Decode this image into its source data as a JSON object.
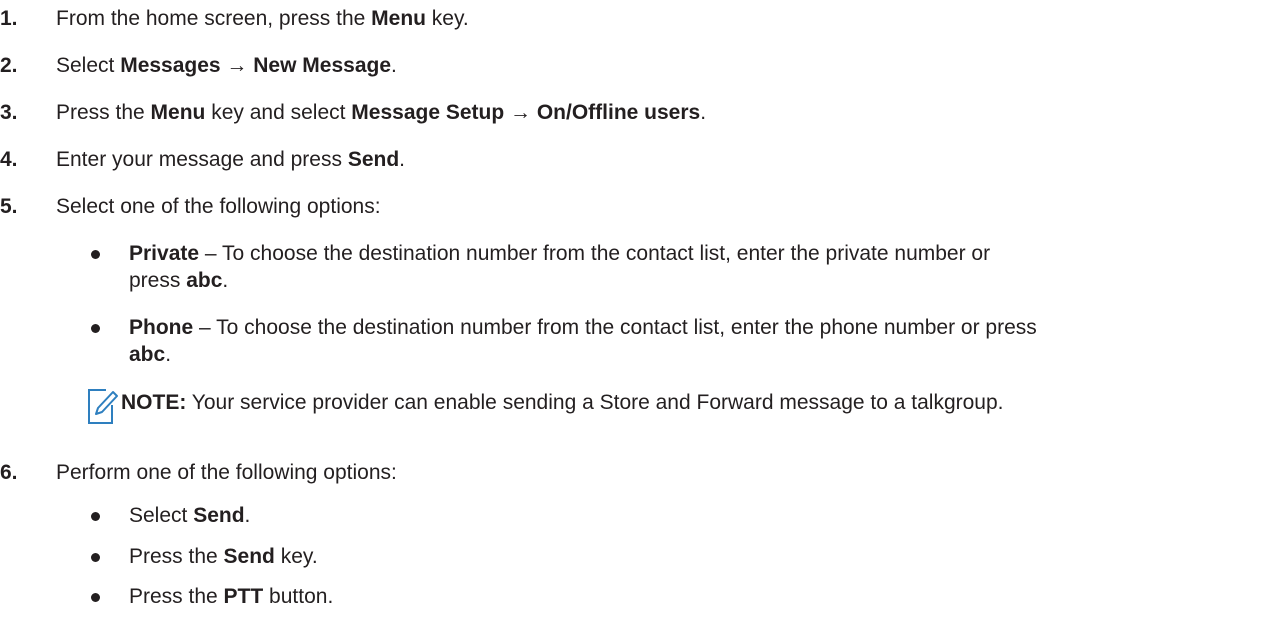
{
  "steps": [
    {
      "number": "1.",
      "parts": [
        "From the home screen, press the ",
        "Menu",
        " key."
      ]
    },
    {
      "number": "2.",
      "parts": [
        "Select ",
        "Messages → New Message",
        "."
      ]
    },
    {
      "number": "3.",
      "parts": [
        "Press the ",
        "Menu",
        " key and select ",
        "Message Setup → On/Offline users",
        "."
      ]
    },
    {
      "number": "4.",
      "parts": [
        "Enter your message and press ",
        "Send",
        "."
      ]
    },
    {
      "number": "5.",
      "parts": [
        "Select one of the following options:"
      ]
    },
    {
      "number": "6.",
      "parts": [
        "Perform one of the following options:"
      ]
    }
  ],
  "step5_options": [
    {
      "term": "Private",
      "line1": " – To choose the destination number from the contact list, enter the private number or",
      "line2_pre": "press ",
      "line2_bold": "abc",
      "line2_post": "."
    },
    {
      "term": "Phone",
      "line1": " – To choose the destination number from the contact list, enter the phone number or press",
      "line2_pre": "",
      "line2_bold": "abc",
      "line2_post": "."
    }
  ],
  "note": {
    "icon": "note-pencil-icon",
    "label": "NOTE:",
    "text": " Your service provider can enable sending a Store and Forward message to a talkgroup."
  },
  "step6_options": [
    {
      "pre": "Select ",
      "bold": "Send",
      "post": "."
    },
    {
      "pre": "Press the ",
      "bold": "Send",
      "post": " key."
    },
    {
      "pre": "Press the ",
      "bold": "PTT",
      "post": " button."
    }
  ],
  "colors": {
    "text": "#231f20",
    "icon": "#2e7fbf"
  }
}
